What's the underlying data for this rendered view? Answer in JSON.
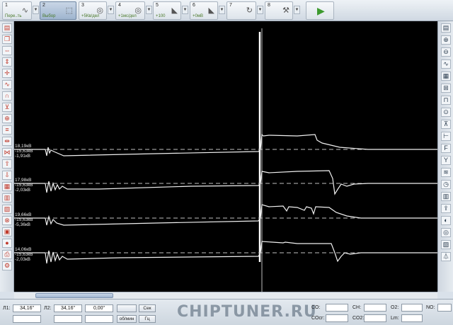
{
  "toolbar": {
    "buttons": [
      {
        "num": "1",
        "sub": "Пере..ть"
      },
      {
        "num": "2",
        "sub": "Выбор"
      },
      {
        "num": "3",
        "sub": "+5Кв/дел"
      },
      {
        "num": "4",
        "sub": "+1мс/дел"
      },
      {
        "num": "5",
        "sub": "+100"
      },
      {
        "num": "6",
        "sub": "+0мВ"
      },
      {
        "num": "7",
        "sub": ""
      },
      {
        "num": "8",
        "sub": ""
      }
    ]
  },
  "channels": [
    {
      "l1": "18,19кВ",
      "l2": "-15,63кВ",
      "l3": "-1,91кВ"
    },
    {
      "l1": "17,98кВ",
      "l2": "-15,63кВ",
      "l3": "-2,03кВ"
    },
    {
      "l1": "19,66кВ",
      "l2": "-15,63кВ",
      "l3": "-5,36кВ"
    },
    {
      "l1": "14,06кВ",
      "l2": "-15,63кВ",
      "l3": "-2,03кВ"
    }
  ],
  "bottom": {
    "p1_label": "Л1:",
    "p1_value": "34,16\"",
    "p2_label": "Л2:",
    "p2_value": "34,16\"",
    "p3_value": "0,00\"",
    "sec_button": "Сек",
    "rpm_button": "об/мин",
    "hz_button": "Гц",
    "watermark": "CHIPTUNER.RU",
    "gas": [
      {
        "label": "CO:"
      },
      {
        "label": "CH:"
      },
      {
        "label": "O2:"
      },
      {
        "label": "NO:"
      },
      {
        "label": "COcr:"
      },
      {
        "label": "CO2:"
      },
      {
        "label": "Lm:"
      }
    ]
  }
}
